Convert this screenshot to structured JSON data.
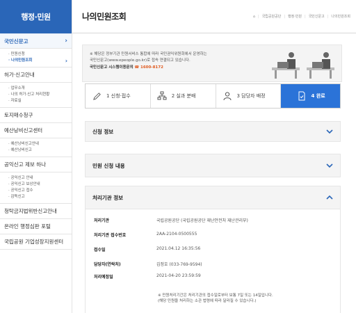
{
  "sidebar": {
    "header": "행정·민원",
    "sections": [
      {
        "label": "국민신문고",
        "active": true
      },
      {
        "label": "허가·신고안내"
      },
      {
        "label": "토지매수청구"
      },
      {
        "label": "예산낭비신고센터"
      },
      {
        "label": "공익신고 제보 하나"
      },
      {
        "label": "청탁금지법위반신고안내"
      },
      {
        "label": "온라인 행정심판 포털"
      },
      {
        "label": "국립공원 기업성장지원센터"
      }
    ],
    "sub1": [
      "· 민원신청",
      "· 나의민원조회"
    ],
    "sub2": [
      "· 업무소개",
      "· 나의 허가·신고 처리현황",
      "· 자료실"
    ],
    "sub3": [
      "· 예산낭비신고안내",
      "· 예산낭비신고"
    ],
    "sub4": [
      "· 공익신고 안내",
      "· 공익신고 보상안내",
      "· 공익신고 접수",
      "· 감독신고"
    ]
  },
  "header": {
    "title": "나의민원조회",
    "breadcrumbs": [
      "국립공원공단",
      "행정·민원",
      "국민신문고",
      "나의민원조회"
    ]
  },
  "banner": {
    "line1": "※ 해당은 정부기관 민원서비스 통합에 따라 국민권익위원회에서 운영하는",
    "line2": "국민신문고(www.epeople.go.kr)로 접속 연결되고 있습니다.",
    "tel_label": "국민신문고 시스템이용문의",
    "tel": "1600-8172"
  },
  "steps": [
    "1 신청·접수",
    "2 실과 분배",
    "3 담당자 배정",
    "4 완료"
  ],
  "accordions": {
    "apply_info": "신청 정보",
    "request_content": "민원 신청 내용",
    "processing_info": "처리기관 정보"
  },
  "processing": {
    "rows": [
      {
        "label": "처리기관",
        "value": "국립공원공단 (국립공원공단 재난안전처 재난관리부)"
      },
      {
        "label": "처리기관 접수번호",
        "value": "2AA-2104-0500555"
      },
      {
        "label": "접수일",
        "value": "2021.04.12 16:35:56"
      },
      {
        "label": "담당자(연락처)",
        "value": "김정호 (033-769-9594)"
      },
      {
        "label": "처리예정일",
        "value": "2021-04-20 23:59:59"
      }
    ],
    "note1": "※ 민원처리기간은 처리기관의 접수일로부터 보통 7일 또는 14일입니다.",
    "note2": "(해당 민원을 처리하는 소관 법령에 따라 달라질 수 있습니다.)"
  },
  "colors": {
    "primary": "#2a66b8",
    "step_active": "#2b73d8",
    "phone": "#e05a1f"
  }
}
